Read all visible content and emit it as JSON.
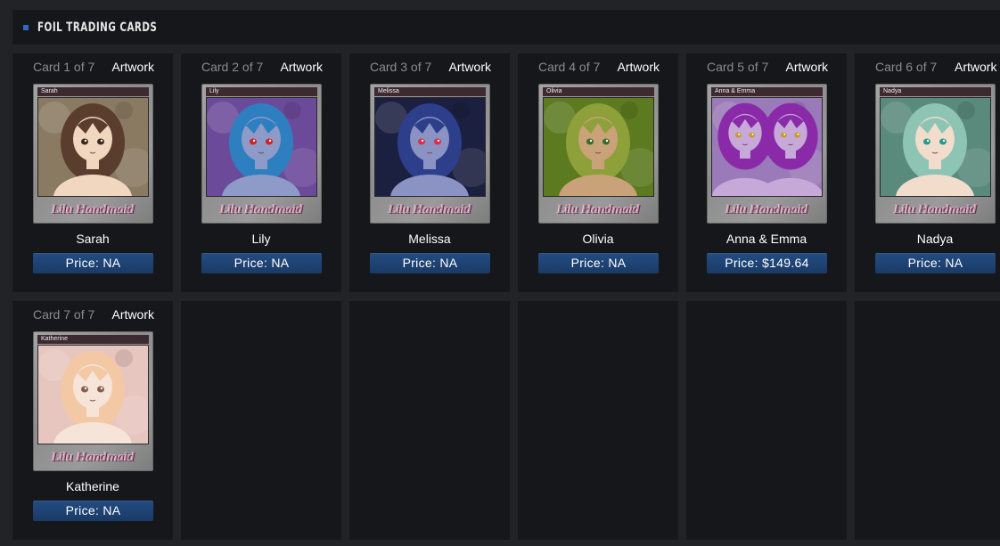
{
  "section": {
    "title": "FOIL TRADING CARDS"
  },
  "cards": [
    {
      "index": "Card 1 of 7",
      "artwork_label": "Artwork",
      "tab_label": "Sarah",
      "name": "Sarah",
      "price": "Price: NA",
      "logo": "Lilu Handmaid",
      "hair_color": "#5a3d2c",
      "bg_color": "#8a7a62",
      "skin_color": "#f1d6c0",
      "eye_color": "#3a2a1e"
    },
    {
      "index": "Card 2 of 7",
      "artwork_label": "Artwork",
      "tab_label": "Lily",
      "name": "Lily",
      "price": "Price: NA",
      "logo": "Lilu Handmaid",
      "hair_color": "#2e7fc0",
      "bg_color": "#6c4a9a",
      "skin_color": "#8e9ac8",
      "eye_color": "#d22020"
    },
    {
      "index": "Card 3 of 7",
      "artwork_label": "Artwork",
      "tab_label": "Melissa",
      "name": "Melissa",
      "price": "Price: NA",
      "logo": "Lilu Handmaid",
      "hair_color": "#2d3f8a",
      "bg_color": "#1c2040",
      "skin_color": "#8b92c4",
      "eye_color": "#e02a4a"
    },
    {
      "index": "Card 4 of 7",
      "artwork_label": "Artwork",
      "tab_label": "Olivia",
      "name": "Olivia",
      "price": "Price: NA",
      "logo": "Lilu Handmaid",
      "hair_color": "#8ea03a",
      "bg_color": "#5c7a20",
      "skin_color": "#c9a27a",
      "eye_color": "#3a6a2a"
    },
    {
      "index": "Card 5 of 7",
      "artwork_label": "Artwork",
      "tab_label": "Anna & Emma",
      "name": "Anna & Emma",
      "price": "Price: $149.64",
      "logo": "Lilu Handmaid",
      "hair_color": "#8a2aa8",
      "bg_color": "#9a7ab8",
      "skin_color": "#c7a9d9",
      "eye_color": "#c89a2a"
    },
    {
      "index": "Card 6 of 7",
      "artwork_label": "Artwork",
      "tab_label": "Nadya",
      "name": "Nadya",
      "price": "Price: NA",
      "logo": "Lilu Handmaid",
      "hair_color": "#8ec4b4",
      "bg_color": "#5a8a7c",
      "skin_color": "#f2dccc",
      "eye_color": "#2a9a8a"
    },
    {
      "index": "Card 7 of 7",
      "artwork_label": "Artwork",
      "tab_label": "Katherine",
      "name": "Katherine",
      "price": "Price: NA",
      "logo": "Lilu Handmaid",
      "hair_color": "#f2c9a4",
      "bg_color": "#e8c6c0",
      "skin_color": "#f7e4d8",
      "eye_color": "#8a5a4a"
    }
  ]
}
